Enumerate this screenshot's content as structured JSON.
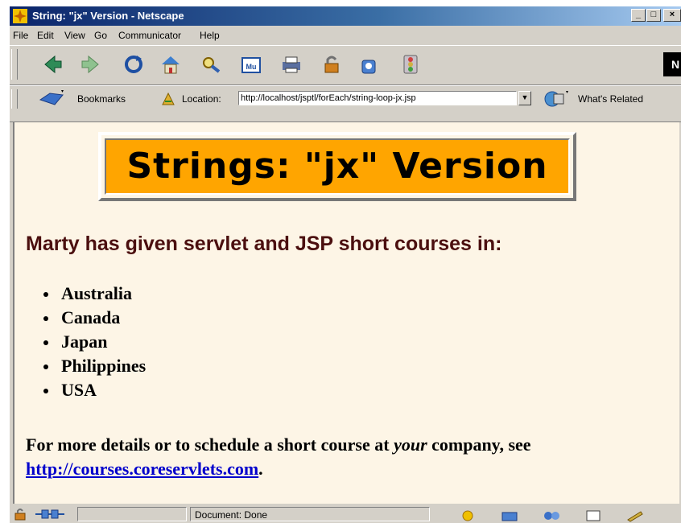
{
  "window": {
    "title": "String: \"jx\" Version - Netscape",
    "controls": {
      "minimize": "_",
      "maximize": "□",
      "close": "×"
    }
  },
  "menu": [
    "File",
    "Edit",
    "View",
    "Go",
    "Communicator",
    "Help"
  ],
  "toolbar": {
    "icons": [
      "back-icon",
      "forward-icon",
      "reload-icon",
      "home-icon",
      "search-icon",
      "my-netscape-icon",
      "print-icon",
      "security-icon",
      "shop-icon",
      "stop-icon"
    ],
    "logo_text": "N"
  },
  "location_bar": {
    "bookmarks_label": "Bookmarks",
    "location_label": "Location:",
    "url": "http://localhost/jsptl/forEach/string-loop-jx.jsp",
    "whats_related_label": "What's Related"
  },
  "page": {
    "title": "Strings: \"jx\" Version",
    "heading": "Marty has given servlet and JSP short courses in:",
    "countries": [
      "Australia",
      "Canada",
      "Japan",
      "Philippines",
      "USA"
    ],
    "paragraph_before": "For more details or to schedule a short course at ",
    "paragraph_em": "your",
    "paragraph_mid": " company, see",
    "link_text": "http://courses.coreservlets.com",
    "paragraph_end": "."
  },
  "status_bar": {
    "text": "Document: Done"
  },
  "colors": {
    "title_bar_start": "#0a246a",
    "page_background": "#fdf5e6",
    "title_box_background": "#ffa500",
    "heading_color": "#4b0f0f",
    "link_color": "#0000cc"
  }
}
